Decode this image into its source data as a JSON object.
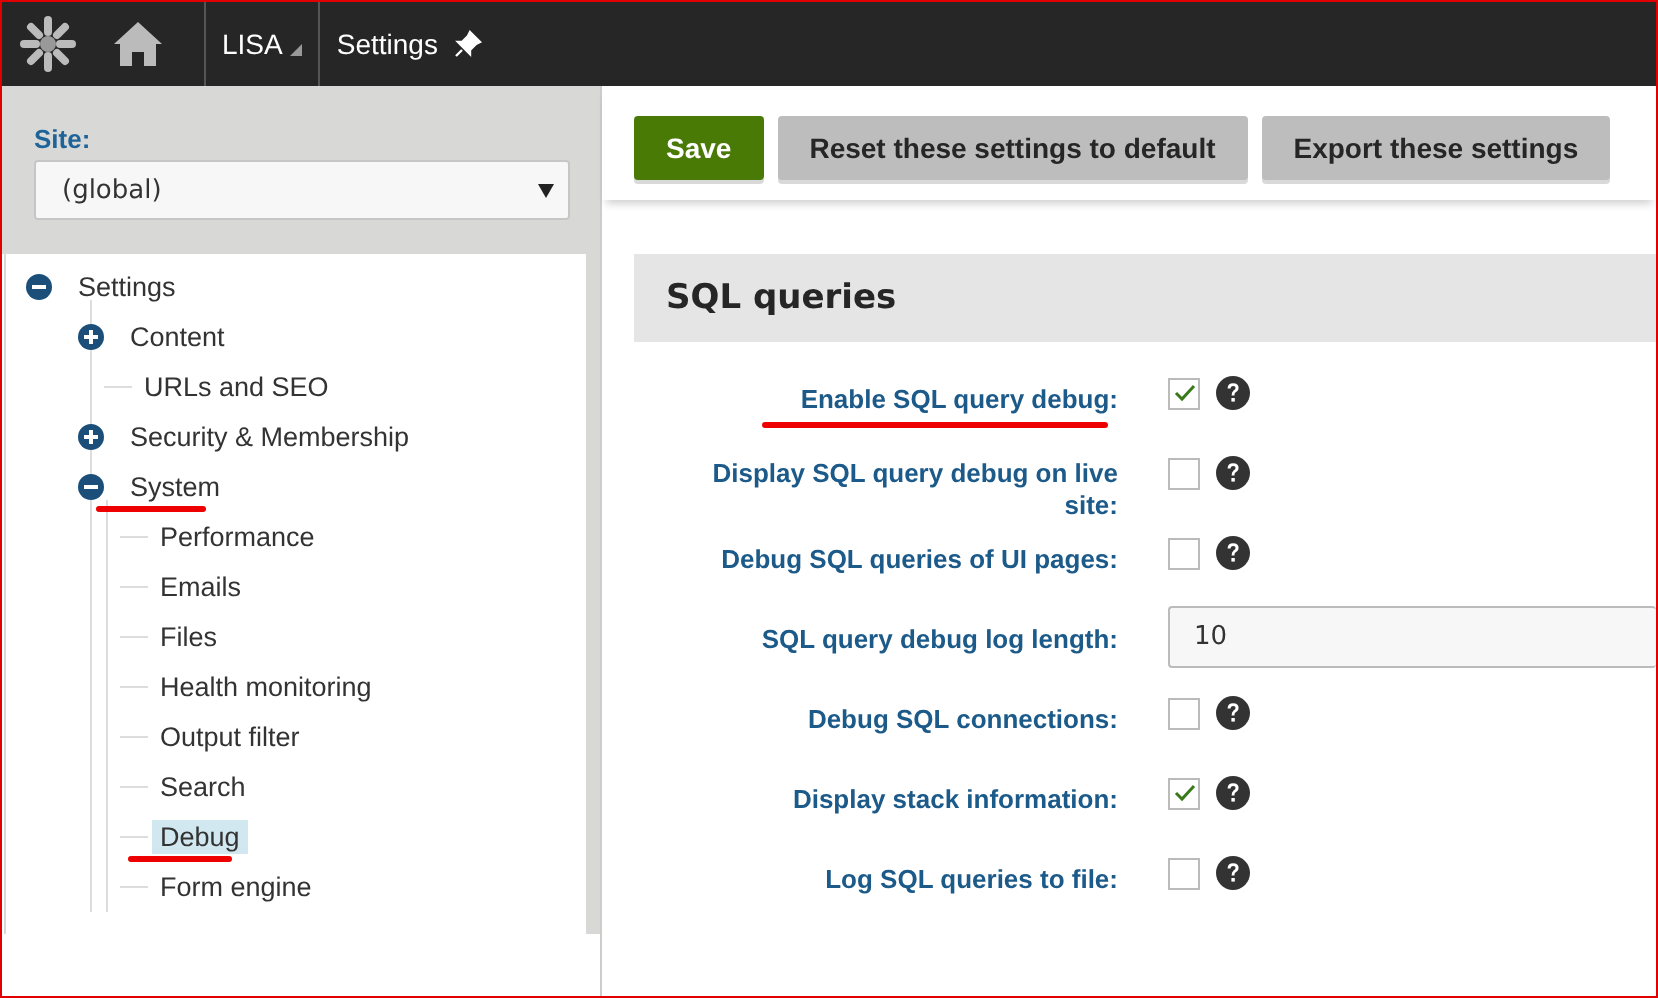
{
  "header": {
    "app_menu": "LISA",
    "app_title": "Settings"
  },
  "site": {
    "label": "Site:",
    "value": "(global)"
  },
  "tree": [
    {
      "label": "Settings",
      "expanded": true,
      "selected": false,
      "underlined": false,
      "children": [
        {
          "label": "Content",
          "expanded": false,
          "selected": false,
          "underlined": false
        },
        {
          "label": "URLs and SEO",
          "selected": false,
          "underlined": false
        },
        {
          "label": "Security & Membership",
          "expanded": false,
          "selected": false,
          "underlined": false
        },
        {
          "label": "System",
          "expanded": true,
          "selected": false,
          "underlined": true,
          "children": [
            {
              "label": "Performance",
              "selected": false,
              "underlined": false
            },
            {
              "label": "Emails",
              "selected": false,
              "underlined": false
            },
            {
              "label": "Files",
              "selected": false,
              "underlined": false
            },
            {
              "label": "Health monitoring",
              "selected": false,
              "underlined": false
            },
            {
              "label": "Output filter",
              "selected": false,
              "underlined": false
            },
            {
              "label": "Search",
              "selected": false,
              "underlined": false
            },
            {
              "label": "Debug",
              "selected": true,
              "underlined": true
            },
            {
              "label": "Form engine",
              "selected": false,
              "underlined": false
            }
          ]
        }
      ]
    }
  ],
  "toolbar": [
    {
      "label": "Save",
      "kind": "primary"
    },
    {
      "label": "Reset these settings to default",
      "kind": "secondary"
    },
    {
      "label": "Export these settings",
      "kind": "secondary"
    }
  ],
  "section": {
    "title": "SQL queries",
    "fields": [
      {
        "label": "Enable SQL query debug:",
        "kind": "checkbox",
        "checked": true,
        "underlined": true
      },
      {
        "label": "Display SQL query debug on live site:",
        "kind": "checkbox",
        "checked": false,
        "underlined": false
      },
      {
        "label": "Debug SQL queries of UI pages:",
        "kind": "checkbox",
        "checked": false,
        "underlined": false
      },
      {
        "label": "SQL query debug log length:",
        "kind": "text",
        "value": "10",
        "underlined": false
      },
      {
        "label": "Debug SQL connections:",
        "kind": "checkbox",
        "checked": false,
        "underlined": false
      },
      {
        "label": "Display stack information:",
        "kind": "checkbox",
        "checked": true,
        "underlined": false
      },
      {
        "label": "Log SQL queries to file:",
        "kind": "checkbox",
        "checked": false,
        "underlined": false
      }
    ]
  }
}
